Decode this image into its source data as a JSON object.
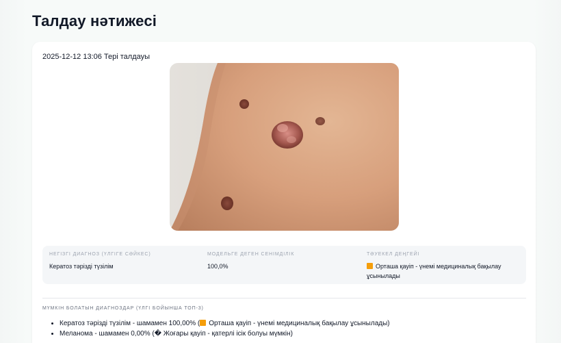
{
  "page": {
    "title": "Талдау нәтижесі"
  },
  "card": {
    "meta": "2025-12-12 13:06 Тері талдауы",
    "summary": {
      "diagnosis_label": "НЕГІЗГІ ДИАГНОЗ (ҮЛГІГЕ СӘЙКЕС)",
      "diagnosis_value": "Кератоз тәрізді түзілім",
      "confidence_label": "МОДЕЛЬГЕ ДЕГЕН СЕНІМДІЛІК",
      "confidence_value": "100,0%",
      "risk_label": "ТӘУЕКЕЛ ДЕҢГЕЙІ",
      "risk_value": "Орташа қауіп - үнемі медициналық бақылау ұсынылады"
    },
    "diagnoses_label": "МҮМКІН БОЛАТЫН ДИАГНОЗДАР (ҮЛГІ БОЙЫНША ТОП-3)",
    "diagnoses": [
      {
        "prefix": "Кератоз тәрізді түзілім - шамамен 100,00% (",
        "risk": "Орташа қауіп - үнемі медициналық бақылау ұсынылады)",
        "icon": "orange-square"
      },
      {
        "prefix": "Меланома - шамамен 0,00% (",
        "risk": "Жоғары қауіп - қатерлі ісік болуы мүмкін)",
        "icon": "unknown-glyph"
      }
    ]
  },
  "colors": {
    "risk_medium": "#f59e0b",
    "background": "#f3f6f5",
    "card": "#ffffff"
  }
}
